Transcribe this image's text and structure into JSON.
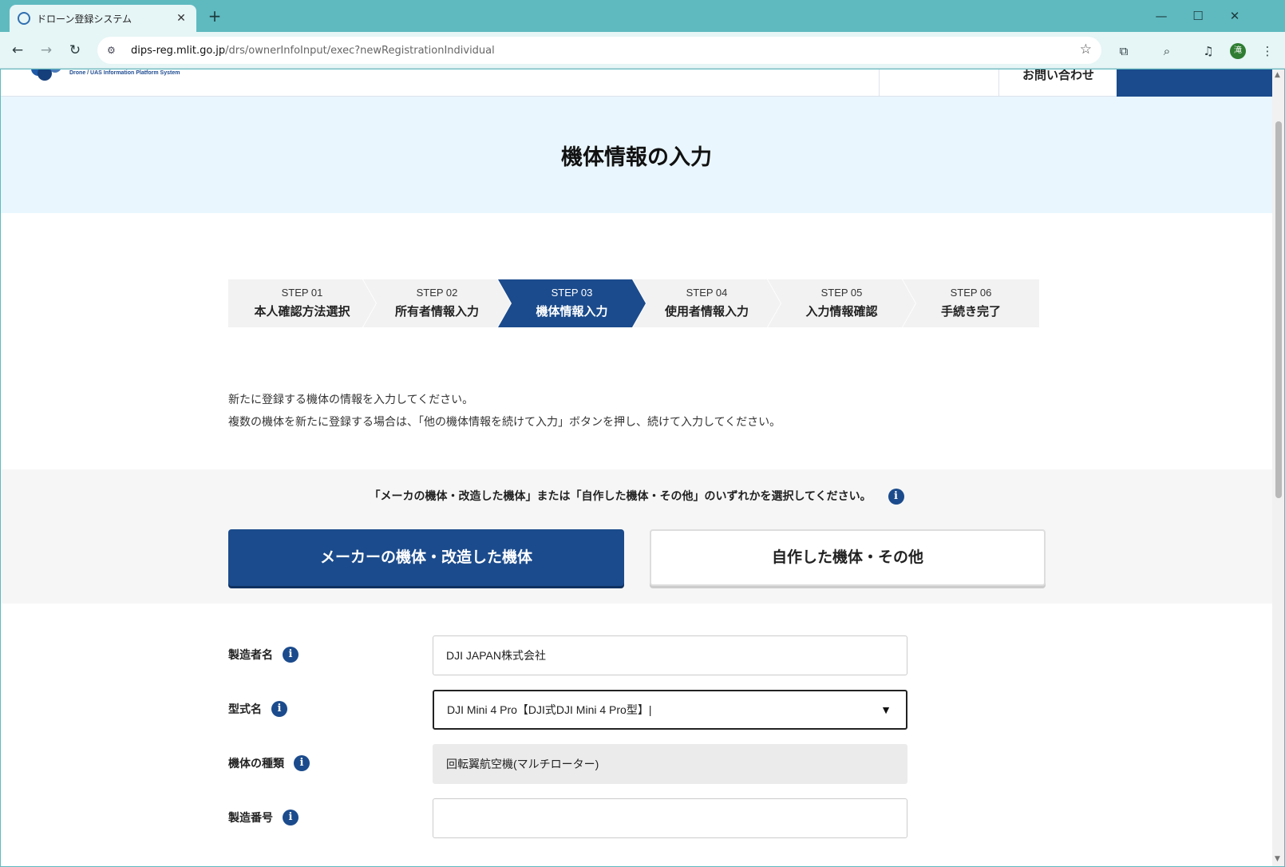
{
  "browser": {
    "tab_title": "ドローン登録システム",
    "tab_close": "✕",
    "new_tab": "+",
    "url_host": "dips-reg.mlit.go.jp",
    "url_path": "/drs/ownerInfoInput/exec?newRegistrationIndividual",
    "profile_initial": "滝",
    "icons": [
      "back-icon",
      "forward-icon",
      "reload-icon",
      "site-settings-icon",
      "star-icon",
      "extensions-icon",
      "lens-icon",
      "media-icon",
      "menu-icon"
    ]
  },
  "header": {
    "logo_subtitle": "Drone / UAS Information Platform System",
    "contact": "お問い合わせ"
  },
  "page": {
    "title": "機体情報の入力"
  },
  "steps": [
    {
      "num": "STEP 01",
      "name": "本人確認方法選択"
    },
    {
      "num": "STEP 02",
      "name": "所有者情報入力"
    },
    {
      "num": "STEP 03",
      "name": "機体情報入力"
    },
    {
      "num": "STEP 04",
      "name": "使用者情報入力"
    },
    {
      "num": "STEP 05",
      "name": "入力情報確認"
    },
    {
      "num": "STEP 06",
      "name": "手続き完了"
    }
  ],
  "intro": {
    "line1": "新たに登録する機体の情報を入力してください。",
    "line2": "複数の機体を新たに登録する場合は、「他の機体情報を続けて入力」ボタンを押し、続けて入力してください。"
  },
  "choice": {
    "question": "「メーカの機体・改造した機体」または「自作した機体・その他」のいずれかを選択してください。",
    "maker_label": "メーカーの機体・改造した機体",
    "self_label": "自作した機体・その他"
  },
  "form": {
    "manufacturer": {
      "label": "製造者名",
      "value": "DJI JAPAN株式会社"
    },
    "model": {
      "label": "型式名",
      "value": "DJI Mini 4 Pro【DJI式DJI Mini 4 Pro型】|"
    },
    "type": {
      "label": "機体の種類",
      "value": "回転翼航空機(マルチローター)"
    },
    "serial": {
      "label": "製造番号",
      "value": ""
    }
  },
  "colors": {
    "navy": "#1b4b8c",
    "hero_bg": "#e9f6fd",
    "chrome": "#5fbac0"
  }
}
